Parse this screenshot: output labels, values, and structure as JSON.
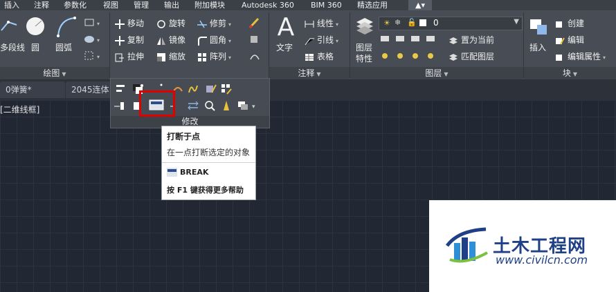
{
  "menubar": {
    "items": [
      "插入",
      "注释",
      "参数化",
      "视图",
      "管理",
      "输出",
      "附加模块",
      "Autodesk 360",
      "BIM 360",
      "精选应用"
    ]
  },
  "ribbon": {
    "draw": {
      "title": "绘图",
      "polyline": "多段线",
      "circle": "圆",
      "arc": "圆弧"
    },
    "modify": {
      "move": "移动",
      "rotate": "旋转",
      "trim": "修剪",
      "copy": "复制",
      "mirror": "镜像",
      "fillet": "圆角",
      "stretch": "拉伸",
      "scale": "缩放",
      "array": "阵列"
    },
    "annotation": {
      "title": "注释",
      "text": "文字",
      "linear": "线性",
      "leader": "引线",
      "table": "表格"
    },
    "layers": {
      "title": "图层",
      "layer_props_line1": "图层",
      "layer_props_line2": "特性",
      "current_layer": "0",
      "set_current": "置为当前",
      "match_layer": "匹配图层"
    },
    "block": {
      "title": "块",
      "insert": "插入",
      "create": "创建",
      "edit": "编辑",
      "edit_attributes": "编辑属性"
    }
  },
  "tabs": {
    "tab1": "0弹簧*",
    "tab2": "2045连体"
  },
  "viewport_label": "[二维线框]",
  "modify_expanded": {
    "title": "修改"
  },
  "tooltip": {
    "title": "打断于点",
    "description": "在一点打断选定的对象",
    "command": "BREAK",
    "help": "按 F1 键获得更多帮助"
  },
  "watermark": {
    "title": "土木工程网",
    "url": "www.civilcn.com"
  },
  "colors": {
    "ribbon": "#484c54",
    "canvas": "#212833",
    "highlight": "#e00000",
    "watermark_text": "#1f3f86"
  }
}
